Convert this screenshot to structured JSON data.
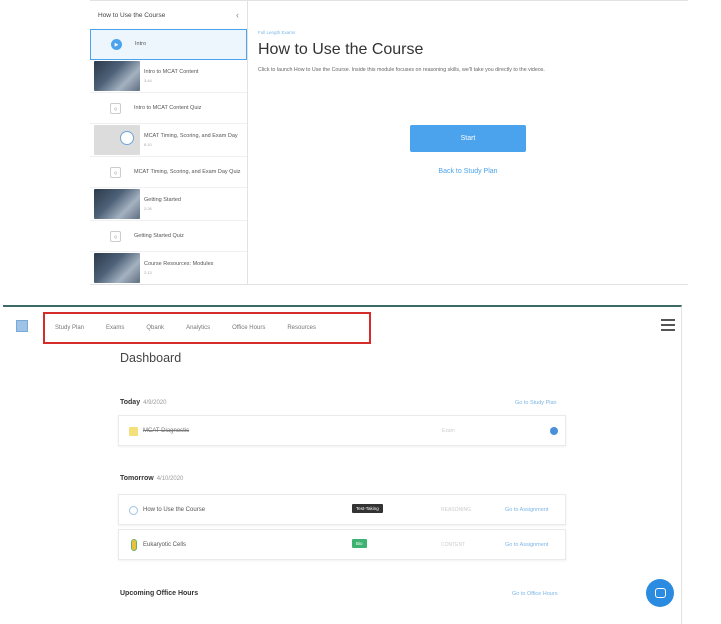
{
  "course": {
    "sidebar": {
      "title": "How to Use the Course",
      "items": [
        {
          "title": "Intro",
          "subtitle": "",
          "kind": "circle",
          "icon_label": "▶",
          "active": true
        },
        {
          "title": "Intro to MCAT Content",
          "subtitle": "3:44",
          "kind": "video",
          "active": false
        },
        {
          "title": "Intro to MCAT Content Quiz",
          "subtitle": "",
          "kind": "quiz",
          "icon_label": "Q",
          "active": false
        },
        {
          "title": "MCAT Timing, Scoring, and Exam Day",
          "subtitle": "6:10",
          "kind": "diagram",
          "active": false
        },
        {
          "title": "MCAT Timing, Scoring, and Exam Day Quiz",
          "subtitle": "",
          "kind": "quiz",
          "icon_label": "Q",
          "active": false
        },
        {
          "title": "Getting Started",
          "subtitle": "2:26",
          "kind": "video",
          "active": false
        },
        {
          "title": "Getting Started Quiz",
          "subtitle": "",
          "kind": "quiz",
          "icon_label": "Q",
          "active": false
        },
        {
          "title": "Course Resources: Modules",
          "subtitle": "2:13",
          "kind": "video",
          "active": false
        }
      ]
    },
    "main": {
      "breadcrumb": "Full Length Exams",
      "title": "How to Use the Course",
      "description": "Click to launch How to Use the Course. Inside this module focuses on reasoning skills, we'll take you directly to the videos.",
      "start_label": "Start",
      "back_label": "Back to Study Plan"
    }
  },
  "dashboard": {
    "nav": [
      "Study Plan",
      "Exams",
      "Qbank",
      "Analytics",
      "Office Hours",
      "Resources"
    ],
    "title": "Dashboard",
    "today": {
      "label": "Today",
      "date": "4/9/2020",
      "link": "Go to Study Plan",
      "items": [
        {
          "name": "MCAT Diagnostic",
          "meta": "Exam",
          "completed": true
        }
      ]
    },
    "tomorrow": {
      "label": "Tomorrow",
      "date": "4/10/2020",
      "items": [
        {
          "name": "How to Use the Course",
          "badge": "Test-Taking",
          "badge_color": "#333333",
          "meta": "REASONING",
          "link": "Go to Assignment"
        },
        {
          "name": "Eukaryotic Cells",
          "badge": "Bio",
          "badge_color": "#3cb371",
          "meta": "CONTENT",
          "link": "Go to Assignment"
        }
      ]
    },
    "office_hours": {
      "label": "Upcoming Office Hours",
      "link": "Go to Office Hours"
    }
  },
  "colors": {
    "accent": "#4aa3ec",
    "highlight_box": "#d52b2b",
    "header_bar": "#3c6a67",
    "chat": "#2a8be0"
  }
}
